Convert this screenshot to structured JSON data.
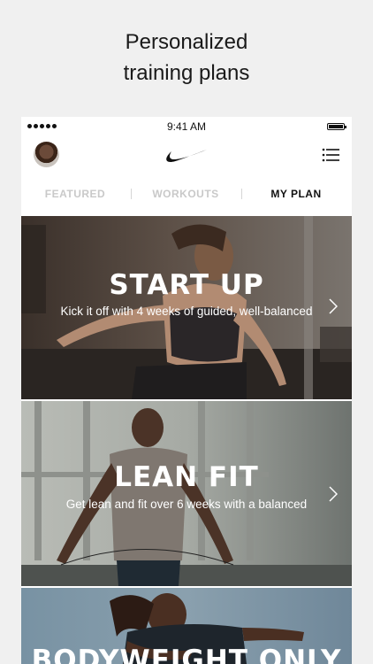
{
  "headline": {
    "line1": "Personalized",
    "line2": "training plans"
  },
  "status_bar": {
    "time": "9:41 AM"
  },
  "navbar": {
    "logo": "swoosh-icon",
    "menu_icon": "list-icon",
    "avatar": "user-avatar"
  },
  "tabs": [
    {
      "label": "FEATURED",
      "active": false
    },
    {
      "label": "WORKOUTS",
      "active": false
    },
    {
      "label": "MY PLAN",
      "active": true
    }
  ],
  "plans": [
    {
      "title": "START UP",
      "subtitle": "Kick it off with 4 weeks of guided, well-balanced"
    },
    {
      "title": "LEAN FIT",
      "subtitle": "Get lean and fit over 6 weeks with a balanced"
    },
    {
      "title": "BODYWEIGHT ONLY",
      "subtitle": ""
    }
  ],
  "colors": {
    "page_bg": "#f0f0f0",
    "active_tab": "#111111",
    "inactive_tab": "#c9c9c9"
  }
}
